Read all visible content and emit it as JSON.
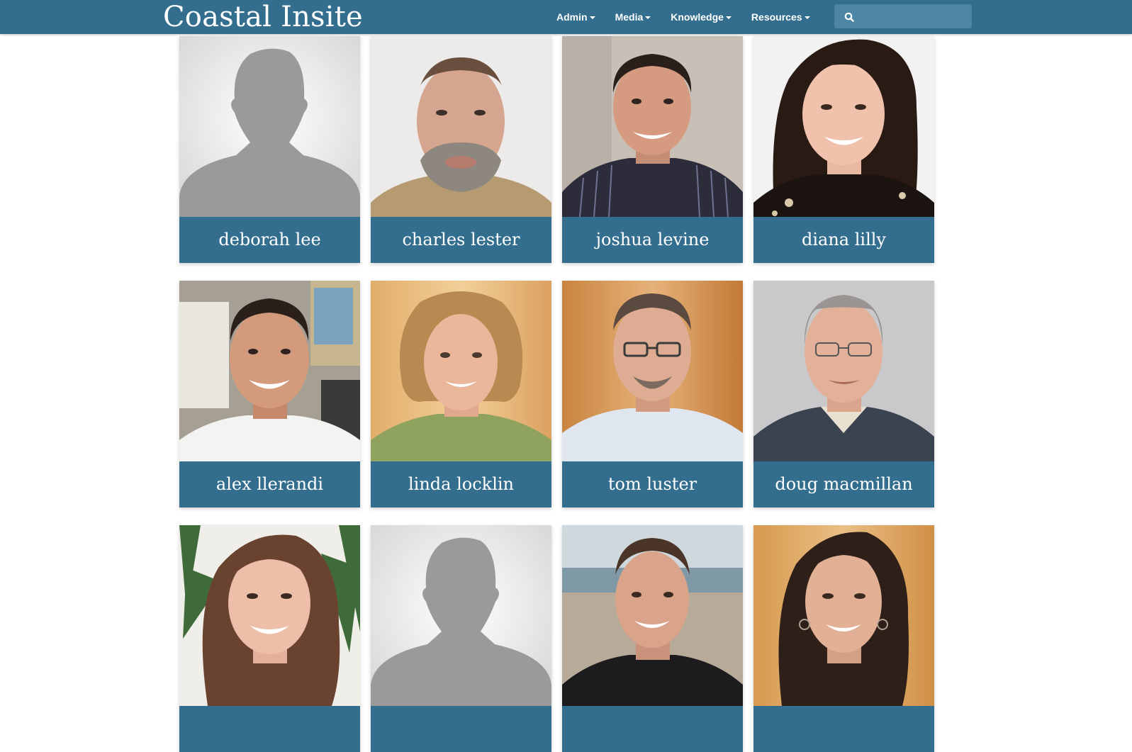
{
  "header": {
    "brand": "Coastal Insite",
    "nav": [
      {
        "label": "Admin"
      },
      {
        "label": "Media"
      },
      {
        "label": "Knowledge"
      },
      {
        "label": "Resources"
      }
    ],
    "search": {
      "placeholder": "",
      "value": ""
    }
  },
  "colors": {
    "navbar": "#336e8e",
    "namebar": "#336e8e",
    "search_bg": "#4d86a4"
  },
  "people": [
    {
      "name": "deborah lee",
      "photo": "placeholder-silhouette"
    },
    {
      "name": "charles lester",
      "photo": "portrait"
    },
    {
      "name": "joshua levine",
      "photo": "portrait"
    },
    {
      "name": "diana lilly",
      "photo": "portrait"
    },
    {
      "name": "alex llerandi",
      "photo": "portrait"
    },
    {
      "name": "linda locklin",
      "photo": "portrait"
    },
    {
      "name": "tom luster",
      "photo": "portrait"
    },
    {
      "name": "doug macmillan",
      "photo": "portrait"
    },
    {
      "name": "",
      "photo": "portrait"
    },
    {
      "name": "",
      "photo": "placeholder-silhouette"
    },
    {
      "name": "",
      "photo": "portrait"
    },
    {
      "name": "",
      "photo": "portrait"
    }
  ]
}
